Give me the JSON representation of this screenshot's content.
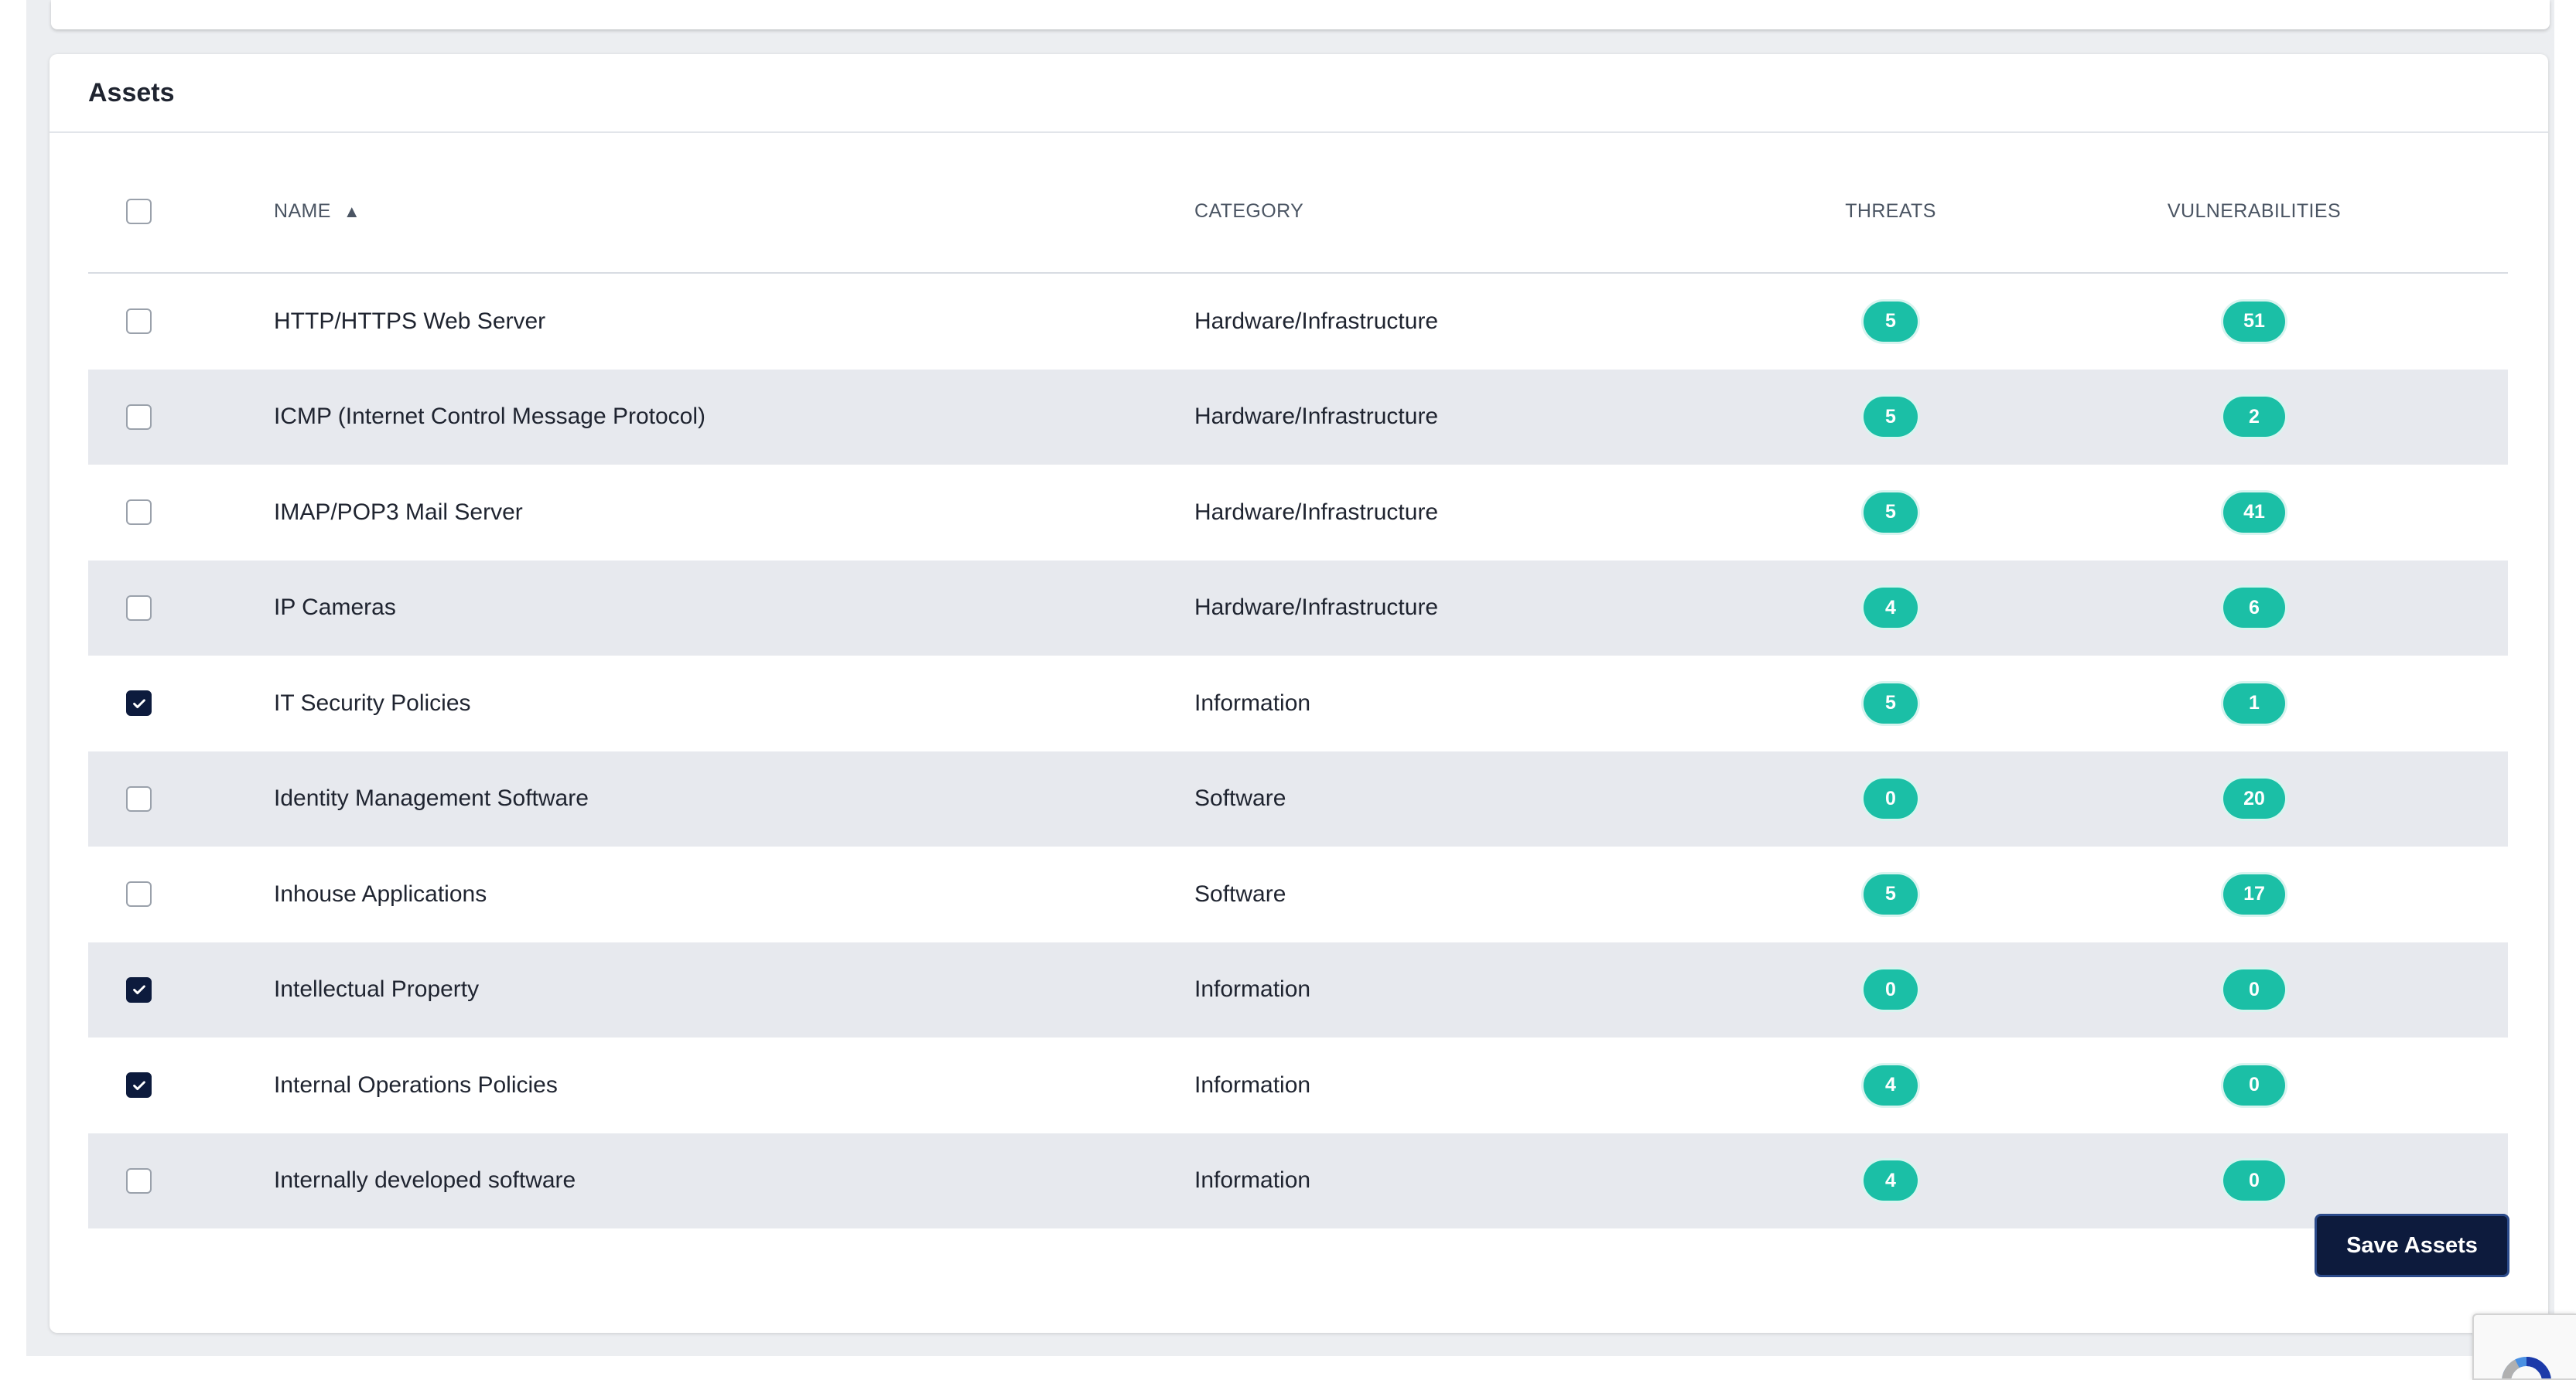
{
  "card": {
    "title": "Assets"
  },
  "table": {
    "headers": {
      "name": "NAME",
      "sort_indicator": "▲",
      "category": "CATEGORY",
      "threats": "THREATS",
      "vulnerabilities": "VULNERABILITIES"
    },
    "select_all_checked": false,
    "rows": [
      {
        "name": "HTTP/HTTPS Web Server",
        "category": "Hardware/Infrastructure",
        "threats": "5",
        "vulnerabilities": "51",
        "checked": false
      },
      {
        "name": "ICMP (Internet Control Message Protocol)",
        "category": "Hardware/Infrastructure",
        "threats": "5",
        "vulnerabilities": "2",
        "checked": false
      },
      {
        "name": "IMAP/POP3 Mail Server",
        "category": "Hardware/Infrastructure",
        "threats": "5",
        "vulnerabilities": "41",
        "checked": false
      },
      {
        "name": "IP Cameras",
        "category": "Hardware/Infrastructure",
        "threats": "4",
        "vulnerabilities": "6",
        "checked": false
      },
      {
        "name": "IT Security Policies",
        "category": "Information",
        "threats": "5",
        "vulnerabilities": "1",
        "checked": true
      },
      {
        "name": "Identity Management Software",
        "category": "Software",
        "threats": "0",
        "vulnerabilities": "20",
        "checked": false
      },
      {
        "name": "Inhouse Applications",
        "category": "Software",
        "threats": "5",
        "vulnerabilities": "17",
        "checked": false
      },
      {
        "name": "Intellectual Property",
        "category": "Information",
        "threats": "0",
        "vulnerabilities": "0",
        "checked": true
      },
      {
        "name": "Internal Operations Policies",
        "category": "Information",
        "threats": "4",
        "vulnerabilities": "0",
        "checked": true
      },
      {
        "name": "Internally developed software",
        "category": "Information",
        "threats": "4",
        "vulnerabilities": "0",
        "checked": false
      }
    ]
  },
  "actions": {
    "save_label": "Save Assets"
  },
  "colors": {
    "badge": "#1bbfa6",
    "primary_button": "#0d1b3d",
    "row_alt": "#e7e9ee"
  }
}
